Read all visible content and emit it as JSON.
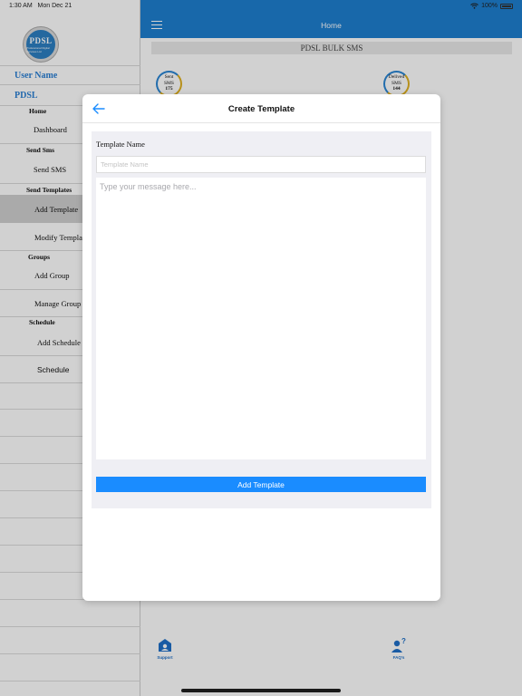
{
  "status_bar": {
    "time": "1:30 AM",
    "date": "Mon Dec 21",
    "battery": "100%"
  },
  "sidebar": {
    "logo_text": "PDSL",
    "logo_subtext": "Professional Digital Services Ltd",
    "user_name": "User Name",
    "org": "PDSL",
    "sections": {
      "home": "Home",
      "send_sms": "Send Sms",
      "send_templates": "Send Templates",
      "groups": "Groups",
      "schedule": "Schedule"
    },
    "items": {
      "dashboard": "Dashboard",
      "send_sms": "Send SMS",
      "add_template": "Add Template",
      "modify_template": "Modify Template",
      "add_group": "Add Group",
      "manage_group": "Manage Group",
      "add_schedule": "Add Schedule",
      "schedule": "Schedule"
    }
  },
  "nav": {
    "title": "Home"
  },
  "banner": "PDSL BULK SMS",
  "stats": {
    "sent": {
      "label1": "Sent",
      "label2": "SMS",
      "value": "175"
    },
    "delivered": {
      "label1": "Delived",
      "label2": "SMS",
      "value": "144"
    }
  },
  "tabs": {
    "support": "Support",
    "faqs": "FAQ's"
  },
  "modal": {
    "title": "Create Template",
    "name_label": "Template Name",
    "name_placeholder": "Template Name",
    "name_value": "",
    "message_placeholder": "Type your message here...",
    "message_value": "",
    "submit_label": "Add Template"
  },
  "colors": {
    "accent": "#1e7fd0",
    "button": "#1a8cff",
    "link": "#2a7fd4"
  }
}
